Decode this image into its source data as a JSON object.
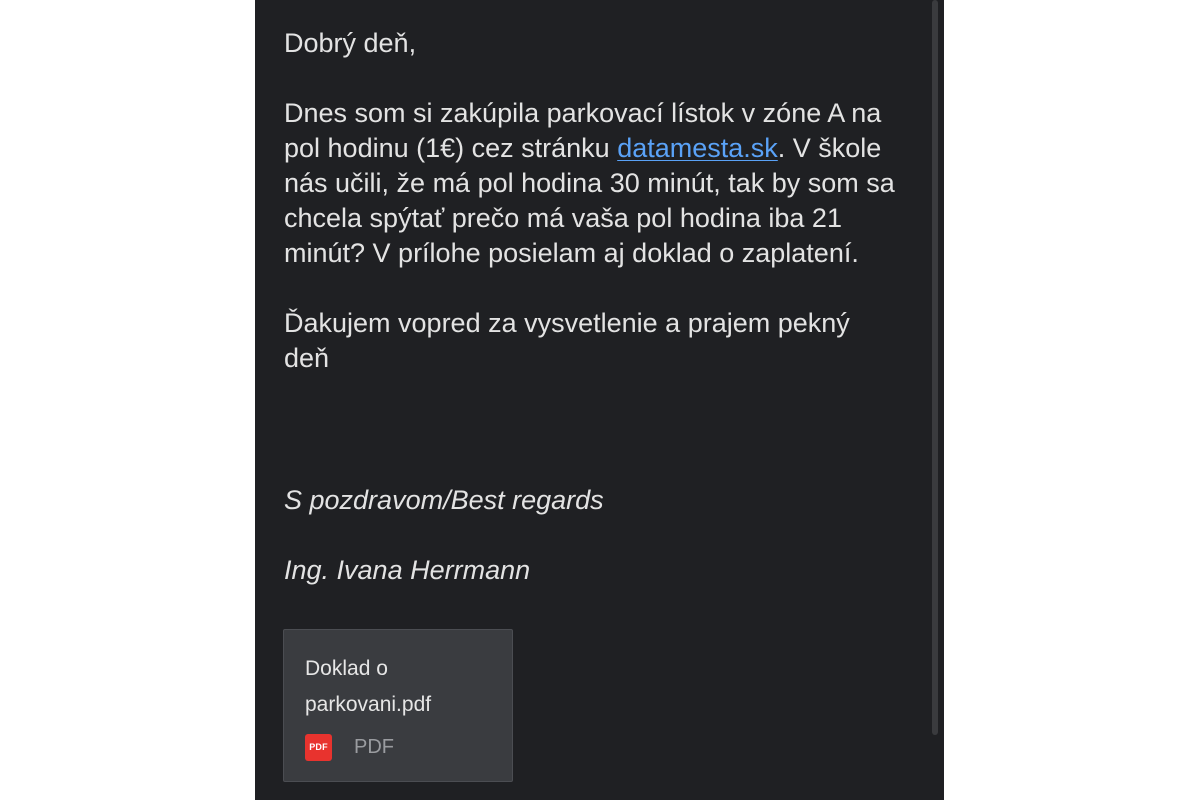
{
  "email": {
    "greeting": "Dobrý deň,",
    "paragraph1_before_link": "Dnes som si zakúpila parkovací lístok v zóne A na pol hodinu (1€) cez stránku ",
    "link_text": "datamesta.sk",
    "paragraph1_after_link": ". V škole nás učili, že má pol hodina 30 minút, tak by som sa chcela spýtať prečo má vaša pol hodina iba 21 minút? V prílohe posielam aj doklad o zaplatení.",
    "paragraph2": "Ďakujem vopred za vysvetlenie a prajem pekný deň",
    "closing": "S pozdravom/Best regards",
    "signature_name": "Ing. Ivana Herrmann"
  },
  "attachment": {
    "file_name": "Doklad o parkovani.pdf",
    "icon_label": "PDF",
    "file_type": "PDF",
    "icon_name": "pdf-file-icon",
    "icon_color": "#e8332e"
  },
  "colors": {
    "background": "#1f2023",
    "text": "#e3e3e3",
    "link": "#5aa2f7",
    "attachment_card": "#3a3c40"
  }
}
